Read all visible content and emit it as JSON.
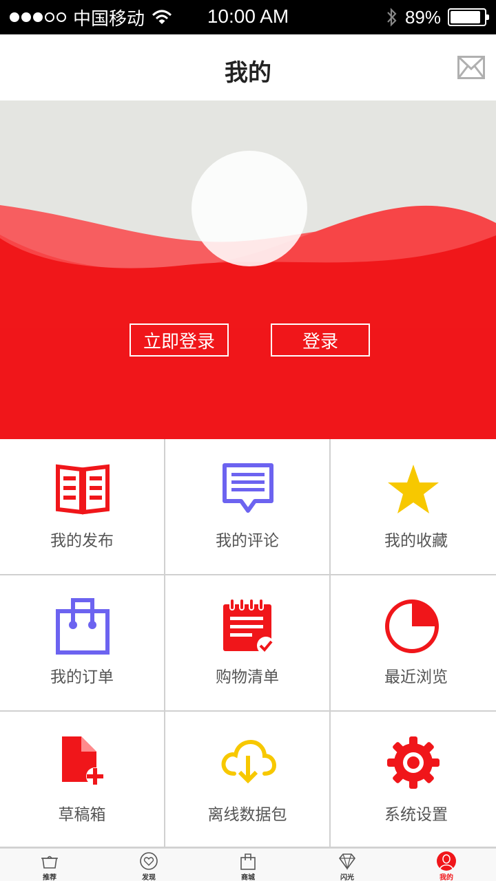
{
  "status_bar": {
    "carrier": "中国移动",
    "time": "10:00 AM",
    "battery": "89%",
    "battery_level": 0.89,
    "signal_bars_filled": 3,
    "signal_bars_total": 5,
    "icons": [
      "wifi-icon",
      "bluetooth-icon",
      "battery-icon"
    ]
  },
  "header": {
    "title": "我的",
    "right_icon": "mail-icon"
  },
  "hero": {
    "avatar_icon": "avatar-placeholder",
    "buttons": [
      {
        "label": "立即登录"
      },
      {
        "label": "登录"
      }
    ],
    "colors": {
      "red": "#f0161a",
      "grey": "#e4e5e1"
    }
  },
  "menu": [
    {
      "label": "我的发布",
      "icon": "book-icon",
      "color": "#f0161a"
    },
    {
      "label": "我的评论",
      "icon": "comment-icon",
      "color": "#6c63f0"
    },
    {
      "label": "我的收藏",
      "icon": "star-icon",
      "color": "#f7c800"
    },
    {
      "label": "我的订单",
      "icon": "shopping-bag-icon",
      "color": "#6c63f0"
    },
    {
      "label": "购物清单",
      "icon": "notepad-icon",
      "color": "#f0161a"
    },
    {
      "label": "最近浏览",
      "icon": "pie-clock-icon",
      "color": "#f0161a"
    },
    {
      "label": "草稿箱",
      "icon": "draft-file-icon",
      "color": "#f0161a"
    },
    {
      "label": "离线数据包",
      "icon": "cloud-download-icon",
      "color": "#f7c800"
    },
    {
      "label": "系统设置",
      "icon": "gear-icon",
      "color": "#f0161a"
    }
  ],
  "tabbar": {
    "items": [
      {
        "label": "推荐",
        "icon": "pot-icon"
      },
      {
        "label": "发现",
        "icon": "heart-circle-icon"
      },
      {
        "label": "商城",
        "icon": "shopping-bag-icon"
      },
      {
        "label": "闪光",
        "icon": "diamond-icon"
      },
      {
        "label": "我的",
        "icon": "user-icon",
        "active": true
      }
    ]
  }
}
